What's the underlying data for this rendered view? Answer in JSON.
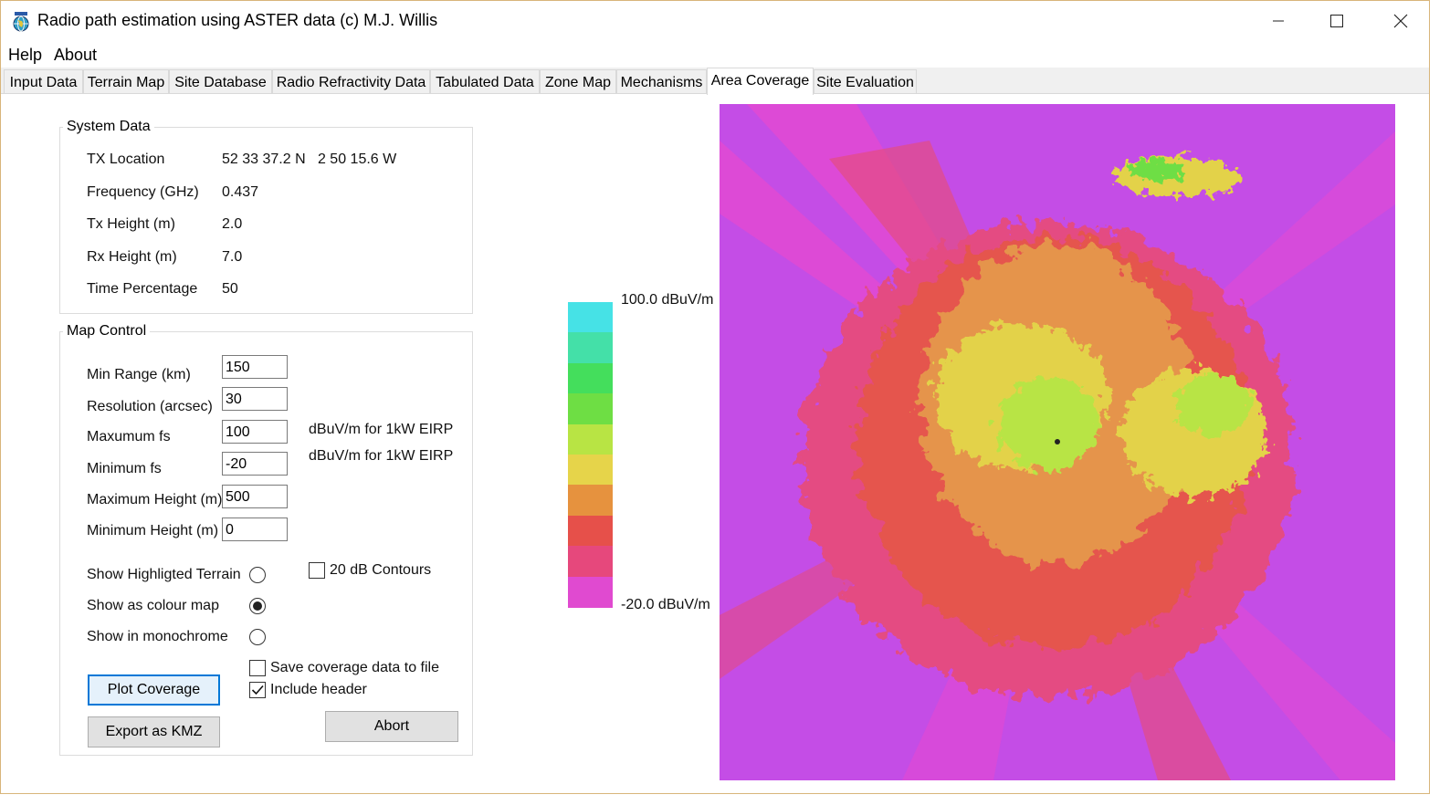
{
  "window": {
    "title": "Radio path estimation using ASTER data (c) M.J. Willis",
    "icon": "globe-app-icon",
    "controls": [
      "minimize-icon",
      "maximize-icon",
      "close-icon"
    ]
  },
  "menu": [
    "Help",
    "About"
  ],
  "tabs": [
    {
      "label": "Input Data"
    },
    {
      "label": "Terrain Map"
    },
    {
      "label": "Site Database"
    },
    {
      "label": "Radio Refractivity Data"
    },
    {
      "label": "Tabulated Data"
    },
    {
      "label": "Zone Map"
    },
    {
      "label": "Mechanisms"
    },
    {
      "label": "Area Coverage",
      "active": true
    },
    {
      "label": "Site Evaluation"
    }
  ],
  "system_data": {
    "group_label": "System Data",
    "rows": [
      {
        "label": "TX Location",
        "value": "52 33 37.2 N   2 50 15.6 W"
      },
      {
        "label": "Frequency (GHz)",
        "value": "0.437"
      },
      {
        "label": "Tx Height (m)",
        "value": "2.0"
      },
      {
        "label": "Rx Height (m)",
        "value": "7.0"
      },
      {
        "label": "Time Percentage",
        "value": "50"
      }
    ]
  },
  "map_control": {
    "group_label": "Map Control",
    "fields": [
      {
        "label": "Min Range (km)",
        "value": "150"
      },
      {
        "label": "Resolution (arcsec)",
        "value": "30"
      },
      {
        "label": "Maxumum fs",
        "value": "100",
        "unit": "dBuV/m for 1kW EIRP"
      },
      {
        "label": "Minimum fs",
        "value": "-20",
        "unit": "dBuV/m for 1kW EIRP"
      },
      {
        "label": "Maximum Height (m)",
        "value": "500"
      },
      {
        "label": "Minimum Height (m)",
        "value": "0"
      }
    ],
    "display_modes": [
      {
        "label": "Show Highligted Terrain",
        "selected": false
      },
      {
        "label": "Show as colour map",
        "selected": true
      },
      {
        "label": "Show in monochrome",
        "selected": false
      }
    ],
    "contours": {
      "label": "20 dB Contours",
      "checked": false
    },
    "save_file": {
      "label": "Save coverage data to file",
      "checked": false
    },
    "include_header": {
      "label": "Include header",
      "checked": true
    },
    "buttons": {
      "plot": "Plot Coverage",
      "export": "Export as KMZ",
      "abort": "Abort"
    }
  },
  "legend": {
    "max_label": "100.0 dBuV/m",
    "min_label": "-20.0 dBuV/m",
    "colors": [
      "#46e2e6",
      "#44e0a8",
      "#44de5c",
      "#6ede44",
      "#b8e444",
      "#e6d44a",
      "#e6923e",
      "#e6504a",
      "#e6487c",
      "#e04ad0"
    ]
  },
  "map": {
    "background": "#c44de6",
    "tx_marker": "transmitter-marker"
  }
}
